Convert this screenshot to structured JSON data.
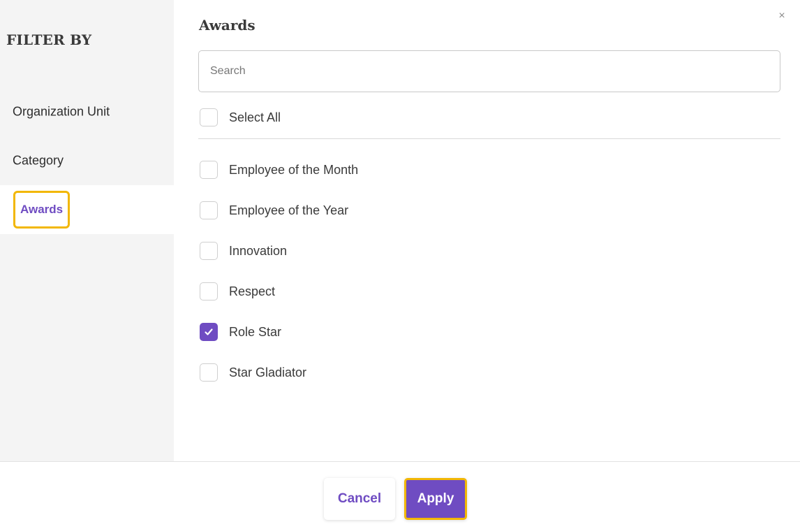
{
  "sidebar": {
    "title": "FILTER BY",
    "items": [
      {
        "label": "Organization Unit",
        "active": false
      },
      {
        "label": "Category",
        "active": false
      },
      {
        "label": "Awards",
        "active": true
      }
    ]
  },
  "panel": {
    "title": "Awards",
    "close_icon": "close-icon",
    "close_glyph": "×",
    "search": {
      "placeholder": "Search",
      "value": ""
    },
    "select_all": {
      "label": "Select All",
      "checked": false
    },
    "options": [
      {
        "label": "Employee of the Month",
        "checked": false
      },
      {
        "label": "Employee of the Year",
        "checked": false
      },
      {
        "label": "Innovation",
        "checked": false
      },
      {
        "label": "Respect",
        "checked": false
      },
      {
        "label": "Role Star",
        "checked": true
      },
      {
        "label": "Star Gladiator",
        "checked": false
      }
    ]
  },
  "footer": {
    "cancel_label": "Cancel",
    "apply_label": "Apply"
  },
  "colors": {
    "accent": "#6f4cc2",
    "highlight": "#f2b705",
    "sidebar_bg": "#f4f4f4"
  }
}
